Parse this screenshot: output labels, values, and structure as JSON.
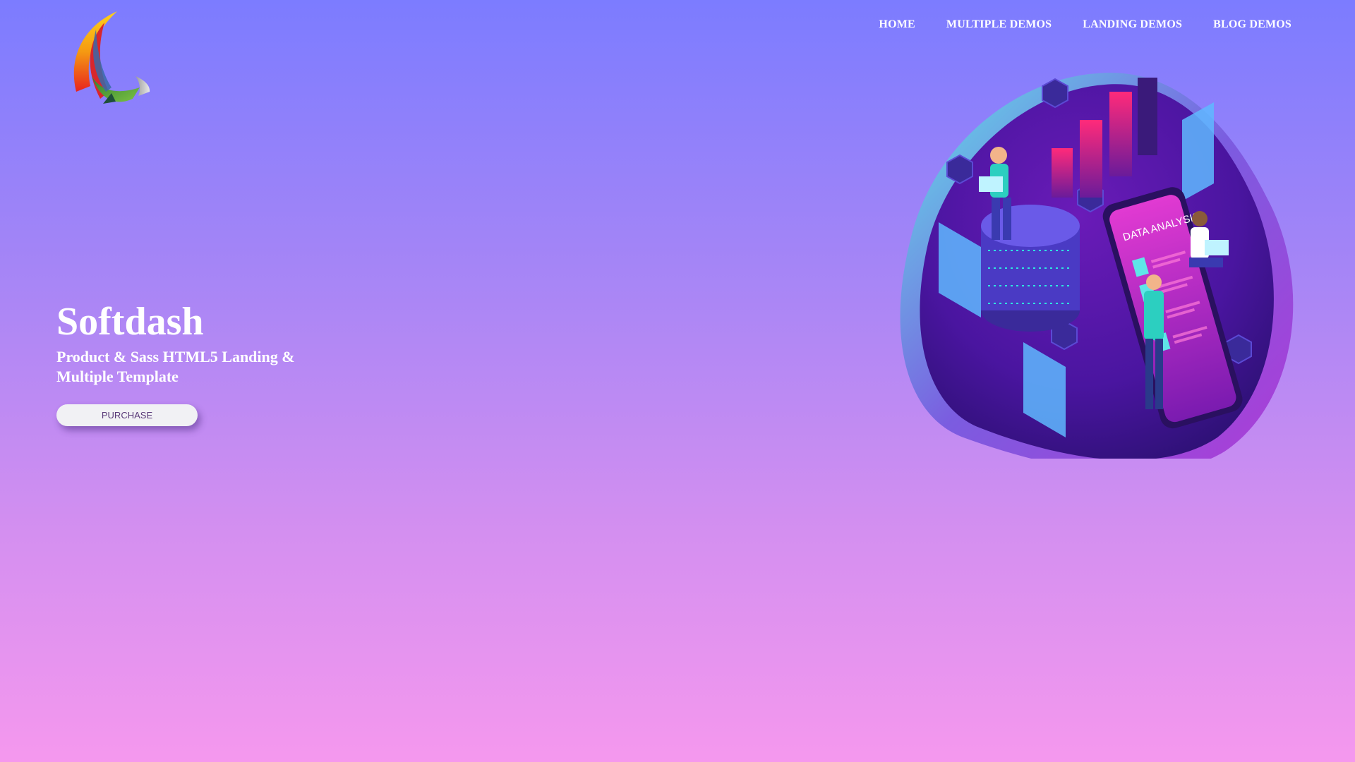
{
  "brand": {
    "logo_icon": "swoosh-logo-icon"
  },
  "nav": {
    "items": [
      {
        "label": "HOME"
      },
      {
        "label": "MULTIPLE DEMOS"
      },
      {
        "label": "LANDING DEMOS"
      },
      {
        "label": "BLOG DEMOS"
      }
    ]
  },
  "hero": {
    "title": "Softdash",
    "subtitle": "Product & Sass HTML5 Landing & Multiple Template",
    "cta_label": "PURCHASE"
  },
  "illustration": {
    "phone_text": "DATA ANALYSIS",
    "icon": "isometric-data-analysis-illustration"
  },
  "colors": {
    "bg_top": "#7c7cff",
    "bg_bottom": "#f598ee",
    "blob_purple": "#8a1fc0",
    "accent_pink": "#ff2a7a",
    "accent_cyan": "#5fe6e8"
  }
}
